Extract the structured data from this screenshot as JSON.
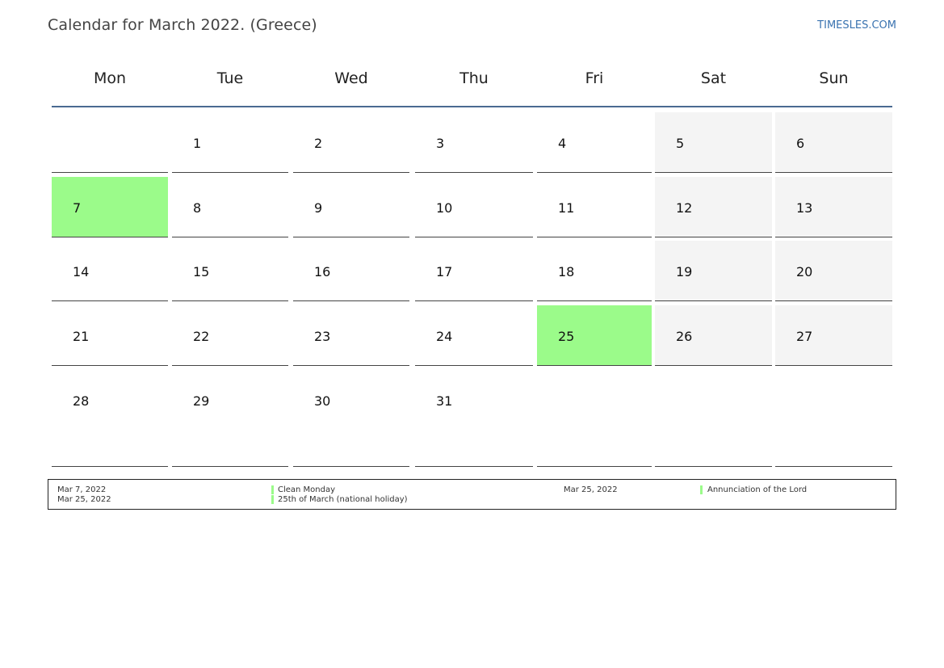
{
  "page": {
    "title": "Calendar for March 2022. (Greece)",
    "site": "TIMESLES.COM"
  },
  "colors": {
    "holiday": "#9bfb8a",
    "weekend": "#f4f4f4",
    "header_rule": "#4a6a91",
    "site_link": "#3a73b0"
  },
  "weekdays": [
    "Mon",
    "Tue",
    "Wed",
    "Thu",
    "Fri",
    "Sat",
    "Sun"
  ],
  "weeks": [
    [
      "",
      "1",
      "2",
      "3",
      "4",
      "5",
      "6"
    ],
    [
      "7",
      "8",
      "9",
      "10",
      "11",
      "12",
      "13"
    ],
    [
      "14",
      "15",
      "16",
      "17",
      "18",
      "19",
      "20"
    ],
    [
      "21",
      "22",
      "23",
      "24",
      "25",
      "26",
      "27"
    ],
    [
      "28",
      "29",
      "30",
      "31",
      "",
      "",
      ""
    ]
  ],
  "holiday_days": [
    "7",
    "25"
  ],
  "legend": {
    "left": [
      {
        "date": "Mar 7, 2022",
        "name": "Clean Monday"
      },
      {
        "date": "Mar 25, 2022",
        "name": "25th of March (national holiday)"
      }
    ],
    "right": [
      {
        "date": "Mar 25, 2022",
        "name": "Annunciation of the Lord"
      }
    ]
  }
}
